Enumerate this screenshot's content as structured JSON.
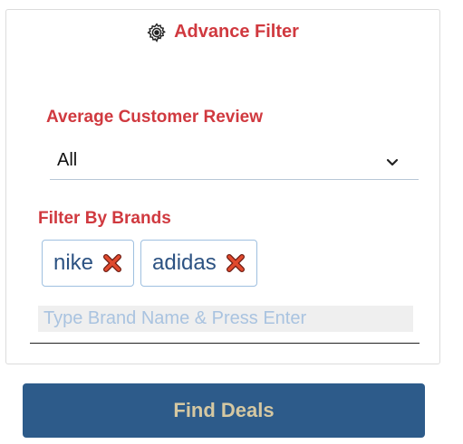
{
  "filter": {
    "title": "Advance Filter",
    "title_icon": "gear-icon",
    "review": {
      "label": "Average Customer Review",
      "selected": "All"
    },
    "brands": {
      "label": "Filter By Brands",
      "tags": [
        {
          "label": "nike",
          "remove_icon": "close-icon"
        },
        {
          "label": "adidas",
          "remove_icon": "close-icon"
        }
      ],
      "input_placeholder": "Type Brand Name & Press Enter",
      "input_value": ""
    }
  },
  "actions": {
    "find_label": "Find Deals"
  },
  "colors": {
    "accent_red": "#d0393f",
    "button_bg": "#2d5b8a",
    "button_text": "#d5c8a2",
    "tag_text": "#2c5282",
    "tag_border": "#9fc0e0",
    "close_icon": "#d9412b"
  }
}
